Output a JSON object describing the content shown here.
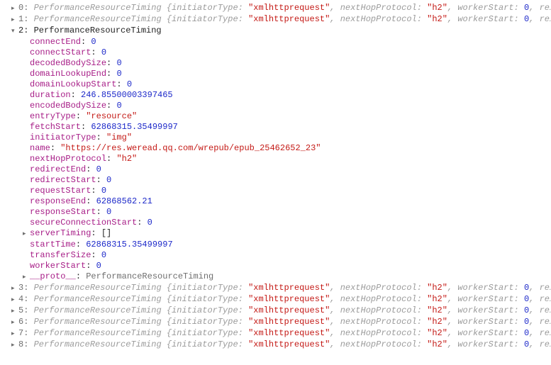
{
  "collapsed_items": [
    {
      "index": 0,
      "class": "PerformanceResourceTiming",
      "summary_keys": [
        "initiatorType",
        "nextHopProtocol",
        "workerStart"
      ],
      "summary_values": [
        "xmlhttprequest",
        "h2",
        0
      ],
      "trailing": "re…"
    },
    {
      "index": 1,
      "class": "PerformanceResourceTiming",
      "summary_keys": [
        "initiatorType",
        "nextHopProtocol",
        "workerStart"
      ],
      "summary_values": [
        "xmlhttprequest",
        "h2",
        0
      ],
      "trailing": "re…"
    }
  ],
  "expanded_item": {
    "index": 2,
    "class": "PerformanceResourceTiming",
    "props": [
      {
        "k": "connectEnd",
        "v": 0,
        "t": "num"
      },
      {
        "k": "connectStart",
        "v": 0,
        "t": "num"
      },
      {
        "k": "decodedBodySize",
        "v": 0,
        "t": "num"
      },
      {
        "k": "domainLookupEnd",
        "v": 0,
        "t": "num"
      },
      {
        "k": "domainLookupStart",
        "v": 0,
        "t": "num"
      },
      {
        "k": "duration",
        "v": 246.85500003397465,
        "t": "num"
      },
      {
        "k": "encodedBodySize",
        "v": 0,
        "t": "num"
      },
      {
        "k": "entryType",
        "v": "resource",
        "t": "str"
      },
      {
        "k": "fetchStart",
        "v": 62868315.35499997,
        "t": "num"
      },
      {
        "k": "initiatorType",
        "v": "img",
        "t": "str"
      },
      {
        "k": "name",
        "v": "https://res.weread.qq.com/wrepub/epub_25462652_23",
        "t": "str"
      },
      {
        "k": "nextHopProtocol",
        "v": "h2",
        "t": "str"
      },
      {
        "k": "redirectEnd",
        "v": 0,
        "t": "num"
      },
      {
        "k": "redirectStart",
        "v": 0,
        "t": "num"
      },
      {
        "k": "requestStart",
        "v": 0,
        "t": "num"
      },
      {
        "k": "responseEnd",
        "v": 62868562.21,
        "t": "num"
      },
      {
        "k": "responseStart",
        "v": 0,
        "t": "num"
      },
      {
        "k": "secureConnectionStart",
        "v": 0,
        "t": "num"
      },
      {
        "k": "serverTiming",
        "v": "[]",
        "t": "arr"
      },
      {
        "k": "startTime",
        "v": 62868315.35499997,
        "t": "num"
      },
      {
        "k": "transferSize",
        "v": 0,
        "t": "num"
      },
      {
        "k": "workerStart",
        "v": 0,
        "t": "num"
      }
    ],
    "proto": "PerformanceResourceTiming"
  },
  "collapsed_items_after": [
    {
      "index": 3,
      "class": "PerformanceResourceTiming",
      "summary_keys": [
        "initiatorType",
        "nextHopProtocol",
        "workerStart"
      ],
      "summary_values": [
        "xmlhttprequest",
        "h2",
        0
      ],
      "trailing": "re…"
    },
    {
      "index": 4,
      "class": "PerformanceResourceTiming",
      "summary_keys": [
        "initiatorType",
        "nextHopProtocol",
        "workerStart"
      ],
      "summary_values": [
        "xmlhttprequest",
        "h2",
        0
      ],
      "trailing": "re…"
    },
    {
      "index": 5,
      "class": "PerformanceResourceTiming",
      "summary_keys": [
        "initiatorType",
        "nextHopProtocol",
        "workerStart"
      ],
      "summary_values": [
        "xmlhttprequest",
        "h2",
        0
      ],
      "trailing": "re…"
    },
    {
      "index": 6,
      "class": "PerformanceResourceTiming",
      "summary_keys": [
        "initiatorType",
        "nextHopProtocol",
        "workerStart"
      ],
      "summary_values": [
        "xmlhttprequest",
        "h2",
        0
      ],
      "trailing": "re…"
    },
    {
      "index": 7,
      "class": "PerformanceResourceTiming",
      "summary_keys": [
        "initiatorType",
        "nextHopProtocol",
        "workerStart"
      ],
      "summary_values": [
        "xmlhttprequest",
        "h2",
        0
      ],
      "trailing": "re…"
    },
    {
      "index": 8,
      "class": "PerformanceResourceTiming",
      "summary_keys": [
        "initiatorType",
        "nextHopProtocol",
        "workerStart"
      ],
      "summary_values": [
        "xmlhttprequest",
        "h2",
        0
      ],
      "trailing": "re…"
    }
  ]
}
